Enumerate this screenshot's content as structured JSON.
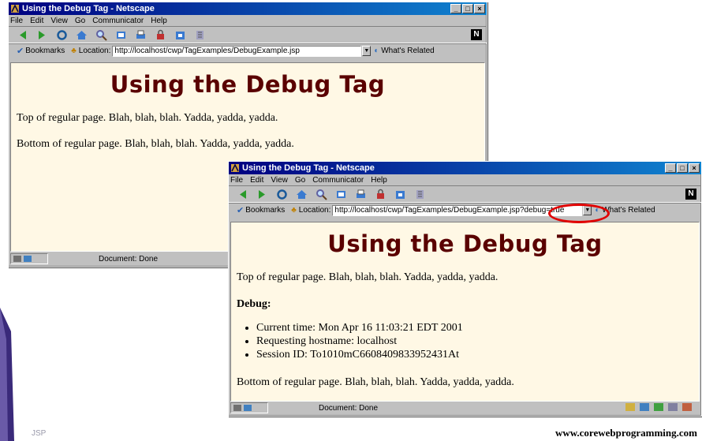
{
  "window1": {
    "title": "Using the Debug Tag - Netscape",
    "menu": [
      "File",
      "Edit",
      "View",
      "Go",
      "Communicator",
      "Help"
    ],
    "bookmarks_label": "Bookmarks",
    "location_label": "Location:",
    "url": "http://localhost/cwp/TagExamples/DebugExample.jsp",
    "related": "What's Related",
    "page": {
      "heading": "Using the Debug Tag",
      "top_text": "Top of regular page. Blah, blah, blah. Yadda, yadda, yadda.",
      "bottom_text": "Bottom of regular page. Blah, blah, blah. Yadda, yadda, yadda."
    },
    "status": "Document: Done"
  },
  "window2": {
    "title": "Using the Debug Tag - Netscape",
    "menu": [
      "File",
      "Edit",
      "View",
      "Go",
      "Communicator",
      "Help"
    ],
    "bookmarks_label": "Bookmarks",
    "location_label": "Location:",
    "url": "http://localhost/cwp/TagExamples/DebugExample.jsp?debug=true",
    "related": "What's Related",
    "page": {
      "heading": "Using the Debug Tag",
      "top_text": "Top of regular page. Blah, blah, blah. Yadda, yadda, yadda.",
      "debug_heading": "Debug:",
      "debug_items": [
        "Current time: Mon Apr 16 11:03:21 EDT 2001",
        "Requesting hostname: localhost",
        "Session ID: To1010mC6608409833952431At"
      ],
      "bottom_text": "Bottom of regular page. Blah, blah, blah. Yadda, yadda, yadda."
    },
    "status": "Document: Done"
  },
  "slide": {
    "footer_left": "JSP",
    "footer_right": "www.corewebprogramming.com"
  },
  "colors": {
    "titlebar": "#000080",
    "page_bg": "#fff8e5",
    "heading": "#5a0000",
    "highlight": "#e00000"
  }
}
